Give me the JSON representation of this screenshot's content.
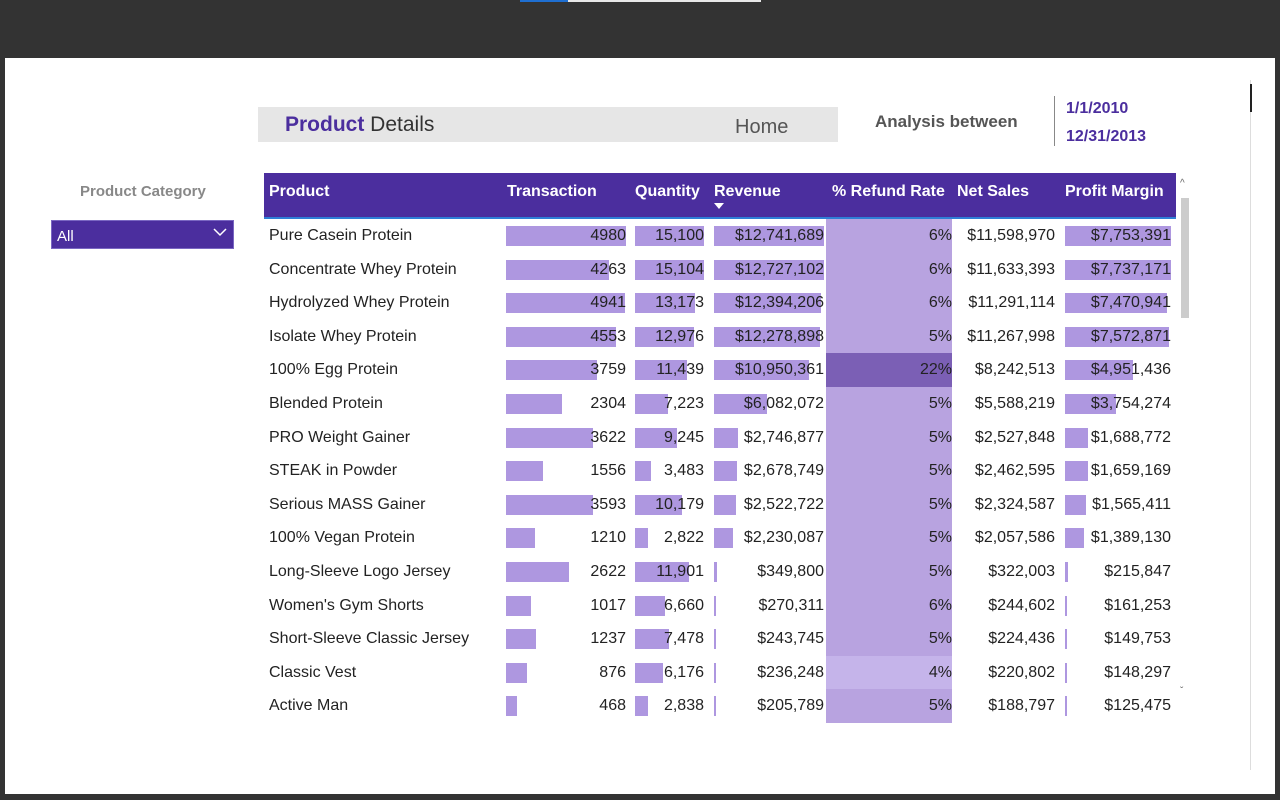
{
  "header": {
    "title_bold": "Product",
    "title_rest": " Details",
    "home_label": "Home"
  },
  "analysis": {
    "label": "Analysis between",
    "start_date": "1/1/2010",
    "end_date": "12/31/2013"
  },
  "filter": {
    "label": "Product Category",
    "value": "All"
  },
  "table": {
    "columns": [
      "Product",
      "Transaction",
      "Quantity",
      "Revenue",
      "% Refund Rate",
      "Net Sales",
      "Profit Margin"
    ],
    "rows": [
      [
        "Pure Casein Protein",
        "4980",
        "15,100",
        "$12,741,689",
        "6%",
        "$11,598,970",
        "$7,753,391"
      ],
      [
        "Concentrate Whey Protein",
        "4263",
        "15,104",
        "$12,727,102",
        "6%",
        "$11,633,393",
        "$7,737,171"
      ],
      [
        "Hydrolyzed Whey Protein",
        "4941",
        "13,173",
        "$12,394,206",
        "6%",
        "$11,291,114",
        "$7,470,941"
      ],
      [
        "Isolate Whey Protein",
        "4553",
        "12,976",
        "$12,278,898",
        "5%",
        "$11,267,998",
        "$7,572,871"
      ],
      [
        "100% Egg Protein",
        "3759",
        "11,439",
        "$10,950,361",
        "22%",
        "$8,242,513",
        "$4,951,436"
      ],
      [
        "Blended Protein",
        "2304",
        "7,223",
        "$6,082,072",
        "5%",
        "$5,588,219",
        "$3,754,274"
      ],
      [
        "PRO Weight Gainer",
        "3622",
        "9,245",
        "$2,746,877",
        "5%",
        "$2,527,848",
        "$1,688,772"
      ],
      [
        "STEAK in Powder",
        "1556",
        "3,483",
        "$2,678,749",
        "5%",
        "$2,462,595",
        "$1,659,169"
      ],
      [
        "Serious MASS Gainer",
        "3593",
        "10,179",
        "$2,522,722",
        "5%",
        "$2,324,587",
        "$1,565,411"
      ],
      [
        "100% Vegan Protein",
        "1210",
        "2,822",
        "$2,230,087",
        "5%",
        "$2,057,586",
        "$1,389,130"
      ],
      [
        "Long-Sleeve Logo Jersey",
        "2622",
        "11,901",
        "$349,800",
        "5%",
        "$322,003",
        "$215,847"
      ],
      [
        "Women's Gym Shorts",
        "1017",
        "6,660",
        "$270,311",
        "6%",
        "$244,602",
        "$161,253"
      ],
      [
        "Short-Sleeve Classic Jersey",
        "1237",
        "7,478",
        "$243,745",
        "5%",
        "$224,436",
        "$149,753"
      ],
      [
        "Classic Vest",
        "876",
        "6,176",
        "$236,248",
        "4%",
        "$220,802",
        "$148,297"
      ],
      [
        "Active Man",
        "468",
        "2,838",
        "$205,789",
        "5%",
        "$188,797",
        "$125,475"
      ]
    ]
  },
  "colors": {
    "brand": "#4b2e9e",
    "bar": "#ae97e0",
    "refund_high": "#7b5fb5",
    "refund_normal": "#b8a3e0",
    "refund_low": "#c5b4ea"
  }
}
